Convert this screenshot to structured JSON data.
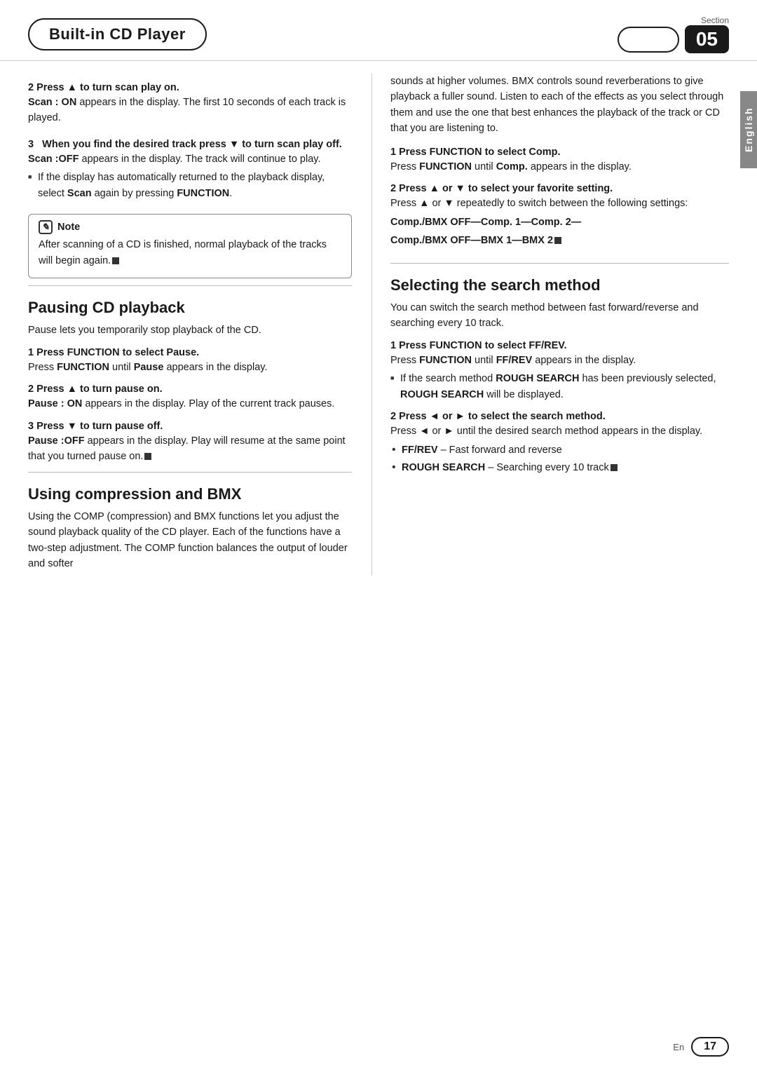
{
  "header": {
    "title": "Built-in CD Player",
    "section_label": "Section",
    "section_num": "05",
    "section_oval_text": ""
  },
  "sidebar": {
    "label": "English"
  },
  "left_col": {
    "step2_title": "2   Press ▲ to turn scan play on.",
    "step2_body1": "Scan : ON appears in the display. The first 10 seconds of each track is played.",
    "step3_title": "3   When you find the desired track press ▼ to turn scan play off.",
    "step3_body1": "Scan :OFF appears in the display. The track will continue to play.",
    "step3_bullet1": "If the display has automatically returned to the playback display, select Scan again by pressing FUNCTION.",
    "note_header": "Note",
    "note_body": "After scanning of a CD is finished, normal playback of the tracks will begin again.",
    "pausing_title": "Pausing CD playback",
    "pausing_intro": "Pause lets you temporarily stop playback of the CD.",
    "pausing_step1_title": "1   Press FUNCTION to select Pause.",
    "pausing_step1_body": "Press FUNCTION until Pause appears in the display.",
    "pausing_step2_title": "2   Press ▲ to turn pause on.",
    "pausing_step2_body": "Pause : ON appears in the display. Play of the current track pauses.",
    "pausing_step3_title": "3   Press ▼ to turn pause off.",
    "pausing_step3_body": "Pause :OFF appears in the display. Play will resume at the same point that you turned pause on.",
    "compression_title": "Using compression and BMX",
    "compression_intro": "Using the COMP (compression) and BMX functions let you adjust the sound playback quality of the CD player. Each of the functions have a two-step adjustment. The COMP function balances the output of louder and softer"
  },
  "right_col": {
    "compression_cont": "sounds at higher volumes. BMX controls sound reverberations to give playback a fuller sound. Listen to each of the effects as you select through them and use the one that best enhances the playback of the track or CD that you are listening to.",
    "comp_step1_title": "1   Press FUNCTION to select Comp.",
    "comp_step1_body": "Press FUNCTION until Comp. appears in the display.",
    "comp_step2_title": "2   Press ▲ or ▼ to select your favorite setting.",
    "comp_step2_body": "Press ▲ or ▼ repeatedly to switch between the following settings:",
    "comp_settings_line1": "Comp./BMX OFF—Comp. 1—Comp. 2—",
    "comp_settings_line2": "Comp./BMX OFF—BMX 1—BMX 2",
    "search_title": "Selecting the search method",
    "search_intro": "You can switch the search method between fast forward/reverse and searching every 10 track.",
    "search_step1_title": "1   Press FUNCTION to select FF/REV.",
    "search_step1_body": "Press FUNCTION until FF/REV appears in the display.",
    "search_step1_bullet1": "If the search method ROUGH SEARCH has been previously selected, ROUGH SEARCH will be displayed.",
    "search_step2_title": "2   Press ◄ or ► to select the search method.",
    "search_step2_body": "Press ◄ or ► until the desired search method appears in the display.",
    "search_bullet_ff": "FF/REV – Fast forward and reverse",
    "search_bullet_rough": "ROUGH SEARCH – Searching every 10 track"
  },
  "footer": {
    "en_label": "En",
    "page_num": "17"
  }
}
